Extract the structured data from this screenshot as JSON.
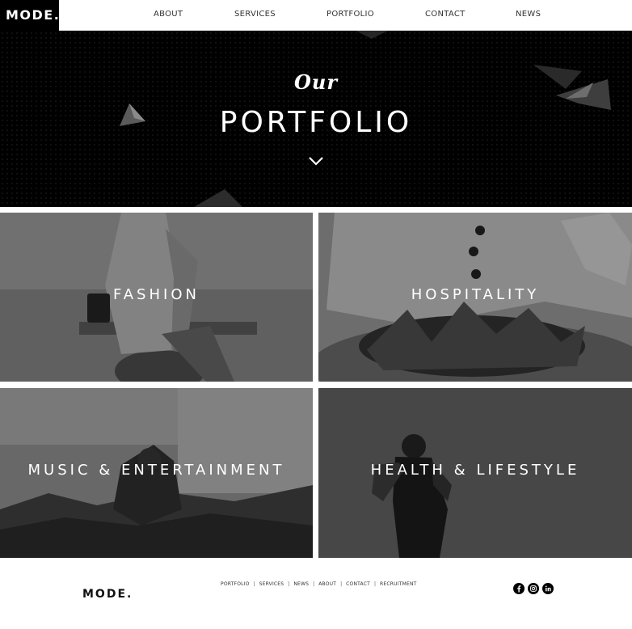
{
  "brand": {
    "logo_text": "MODE.",
    "footer_logo_text": "MODE."
  },
  "nav": {
    "items": [
      {
        "label": "ABOUT"
      },
      {
        "label": "SERVICES"
      },
      {
        "label": "PORTFOLIO"
      },
      {
        "label": "CONTACT"
      },
      {
        "label": "NEWS"
      }
    ]
  },
  "hero": {
    "eyebrow": "Our",
    "title": "PORTFOLIO",
    "scroll_icon": "chevron-down-icon"
  },
  "portfolio": {
    "tiles": [
      {
        "label": "FASHION"
      },
      {
        "label": "HOSPITALITY"
      },
      {
        "label": "MUSIC & ENTERTAINMENT"
      },
      {
        "label": "HEALTH & LIFESTYLE"
      }
    ]
  },
  "footer": {
    "links": [
      {
        "label": "PORTFOLIO"
      },
      {
        "label": "SERVICES"
      },
      {
        "label": "NEWS"
      },
      {
        "label": "ABOUT"
      },
      {
        "label": "CONTACT"
      },
      {
        "label": "RECRUITMENT"
      }
    ],
    "separator": "|",
    "social_icons": [
      "facebook-icon",
      "instagram-icon",
      "linkedin-icon"
    ]
  },
  "colors": {
    "header_bg": "#ffffff",
    "logo_bg": "#000000",
    "hero_bg": "#000000",
    "text_on_dark": "#ffffff",
    "footer_bg": "#ffffff"
  }
}
